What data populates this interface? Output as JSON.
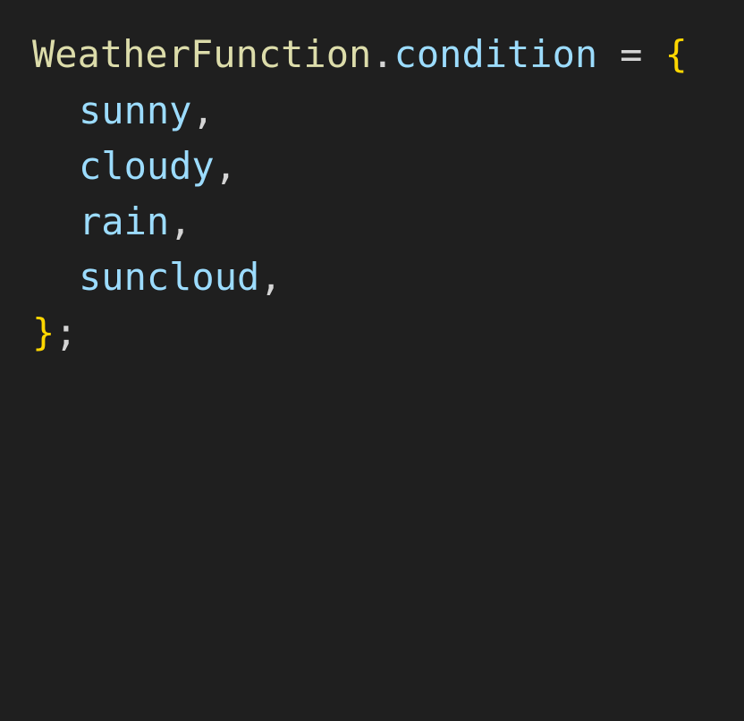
{
  "code": {
    "line1": {
      "object": "WeatherFunction",
      "dot": ".",
      "property": "condition",
      "assign": "=",
      "open_brace": "{"
    },
    "members": [
      {
        "name": "sunny",
        "comma": ","
      },
      {
        "name": "cloudy",
        "comma": ","
      },
      {
        "name": "rain",
        "comma": ","
      },
      {
        "name": "suncloud",
        "comma": ","
      }
    ],
    "closing": {
      "close_brace": "}",
      "semicolon": ";"
    }
  },
  "colors": {
    "background": "#1f1f1f",
    "class_name": "#dcdcaa",
    "property": "#9cdcfe",
    "punctuation": "#d4d4d4",
    "brace": "#ffd700"
  }
}
